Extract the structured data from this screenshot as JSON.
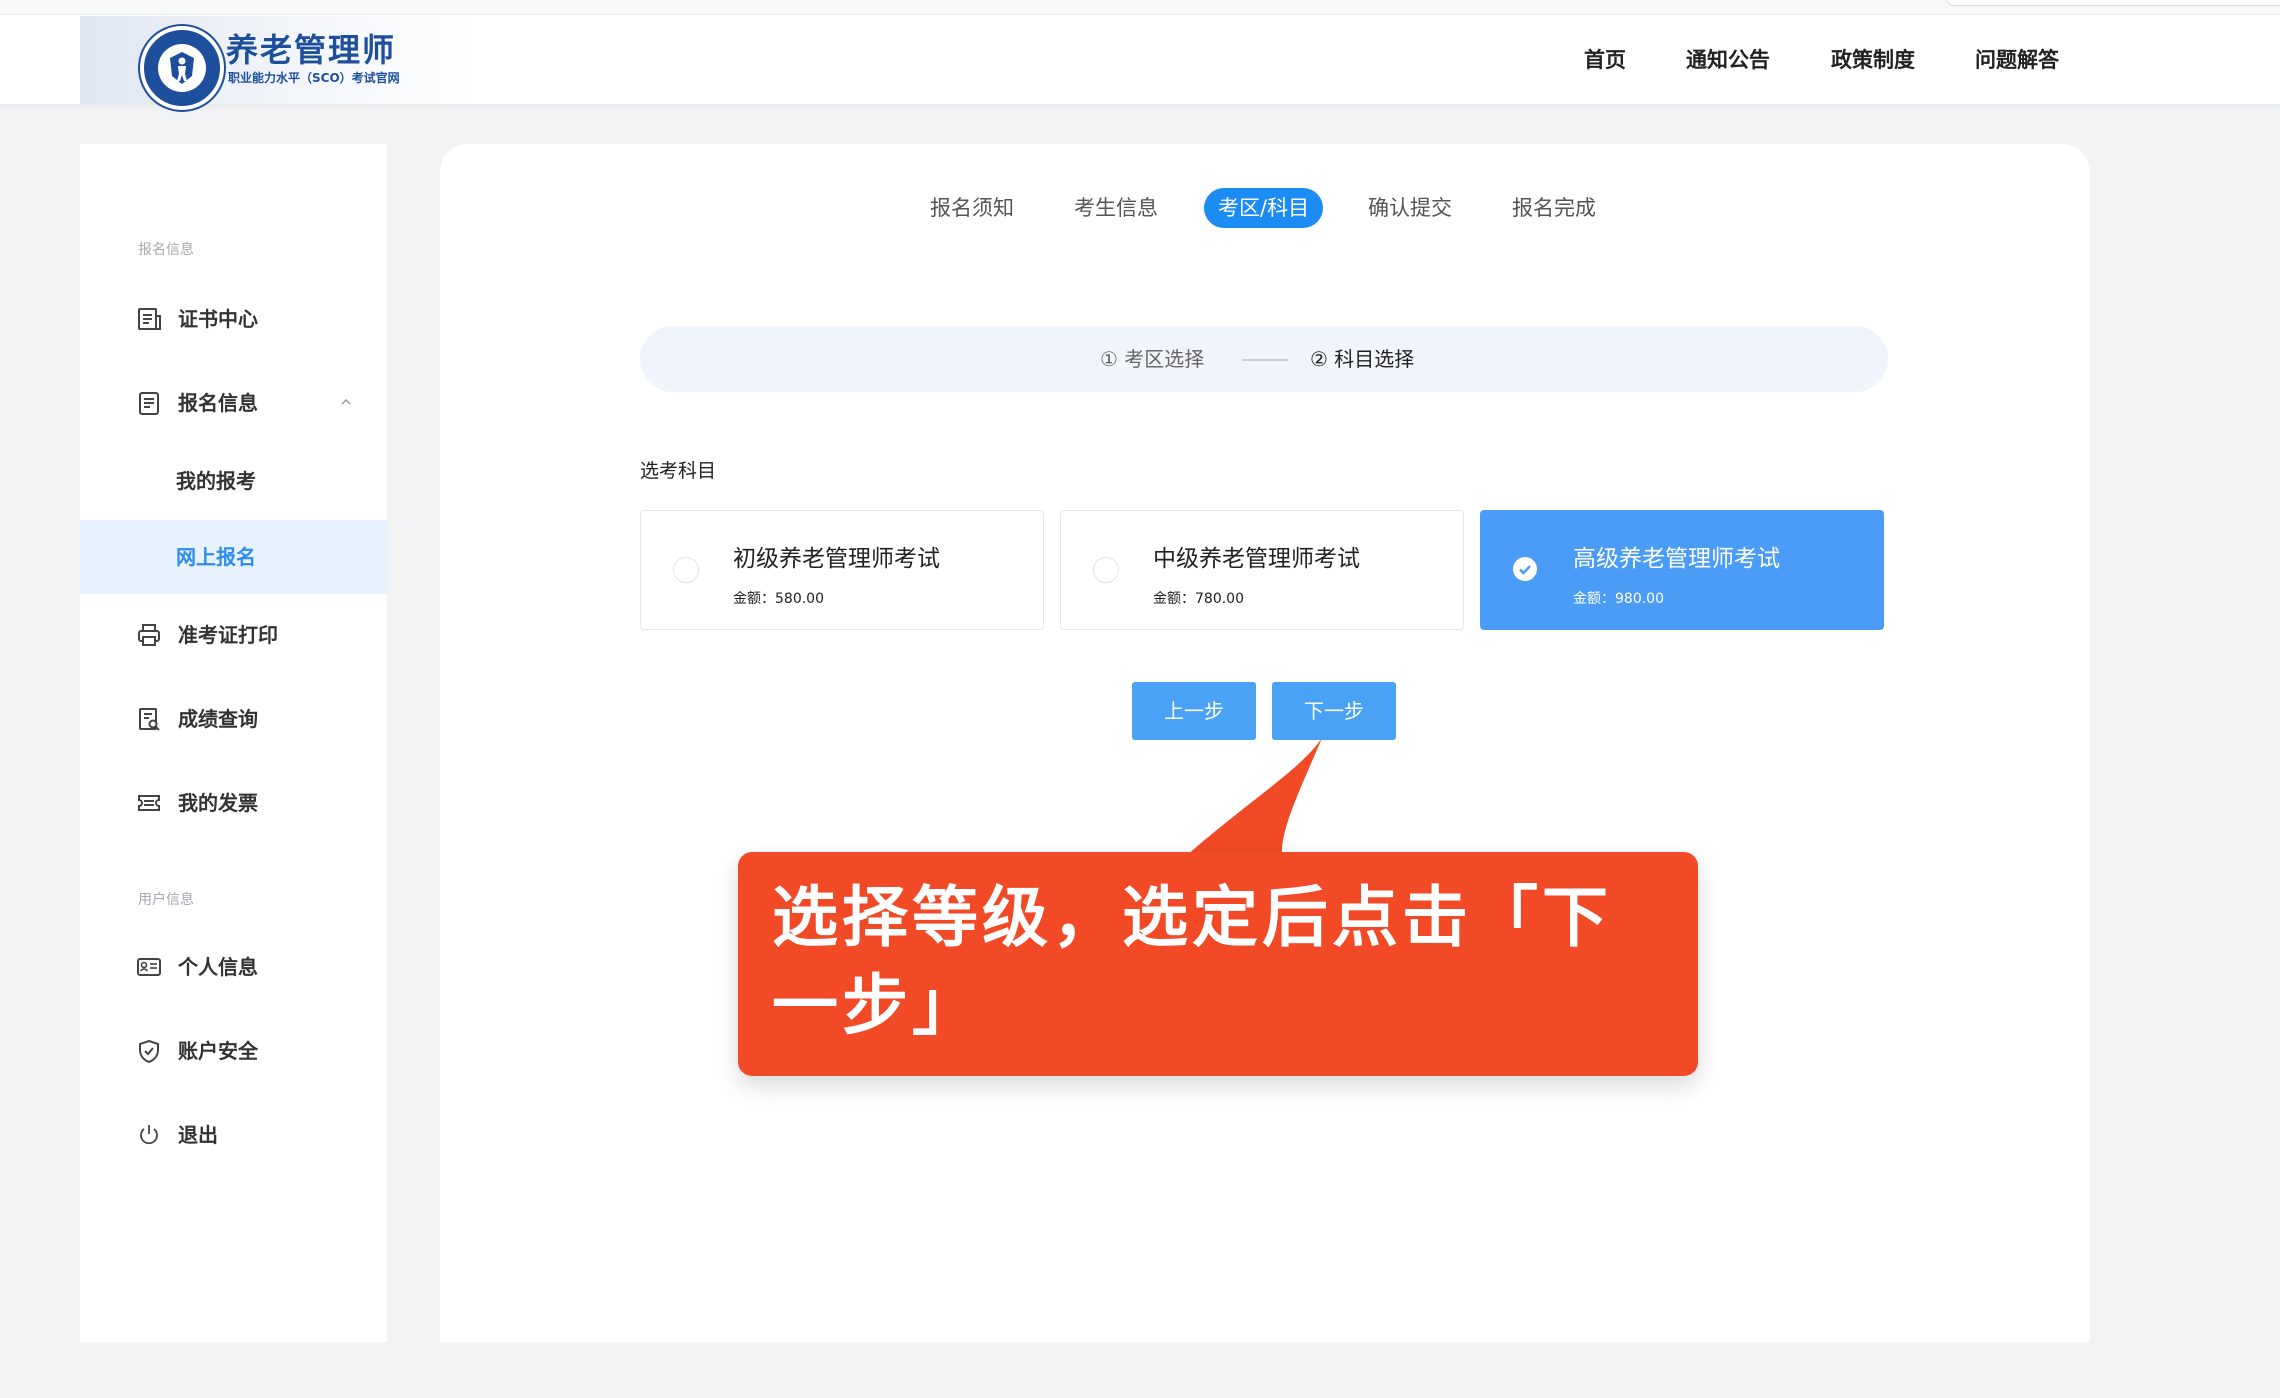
{
  "header": {
    "logo_title": "养老管理师",
    "logo_subtitle": "职业能力水平（SCO）考试官网",
    "nav": [
      {
        "label": "首页"
      },
      {
        "label": "通知公告"
      },
      {
        "label": "政策制度"
      },
      {
        "label": "问题解答"
      }
    ]
  },
  "sidebar": {
    "section_signup": "报名信息",
    "section_user": "用户信息",
    "items": [
      {
        "label": "证书中心",
        "icon": "document-list-icon"
      },
      {
        "label": "报名信息",
        "icon": "form-icon"
      },
      {
        "label": "我的报考"
      },
      {
        "label": "网上报名"
      },
      {
        "label": "准考证打印",
        "icon": "printer-icon"
      },
      {
        "label": "成绩查询",
        "icon": "search-document-icon"
      },
      {
        "label": "我的发票",
        "icon": "ticket-icon"
      },
      {
        "label": "个人信息",
        "icon": "id-card-icon"
      },
      {
        "label": "账户安全",
        "icon": "shield-icon"
      },
      {
        "label": "退出",
        "icon": "power-icon"
      }
    ]
  },
  "steps": [
    {
      "label": "报名须知"
    },
    {
      "label": "考生信息"
    },
    {
      "label": "考区/科目",
      "active": true
    },
    {
      "label": "确认提交"
    },
    {
      "label": "报名完成"
    }
  ],
  "substeps": [
    {
      "label": "① 考区选择"
    },
    {
      "label": "② 科目选择",
      "active": true
    }
  ],
  "subject_label": "选考科目",
  "subjects": [
    {
      "name": "初级养老管理师考试",
      "fee_label": "金额：",
      "fee": "580.00",
      "selected": false
    },
    {
      "name": "中级养老管理师考试",
      "fee_label": "金额：",
      "fee": "780.00",
      "selected": false
    },
    {
      "name": "高级养老管理师考试",
      "fee_label": "金额：",
      "fee": "980.00",
      "selected": true
    }
  ],
  "buttons": {
    "prev": "上一步",
    "next": "下一步"
  },
  "callout": {
    "text": "选择等级，选定后点击「下一步」"
  },
  "colors": {
    "primary": "#1c8cf5",
    "selected_card": "#4a9cf7",
    "button": "#4aa2f6",
    "callout": "#f24a27",
    "brand": "#1e4f9c"
  }
}
